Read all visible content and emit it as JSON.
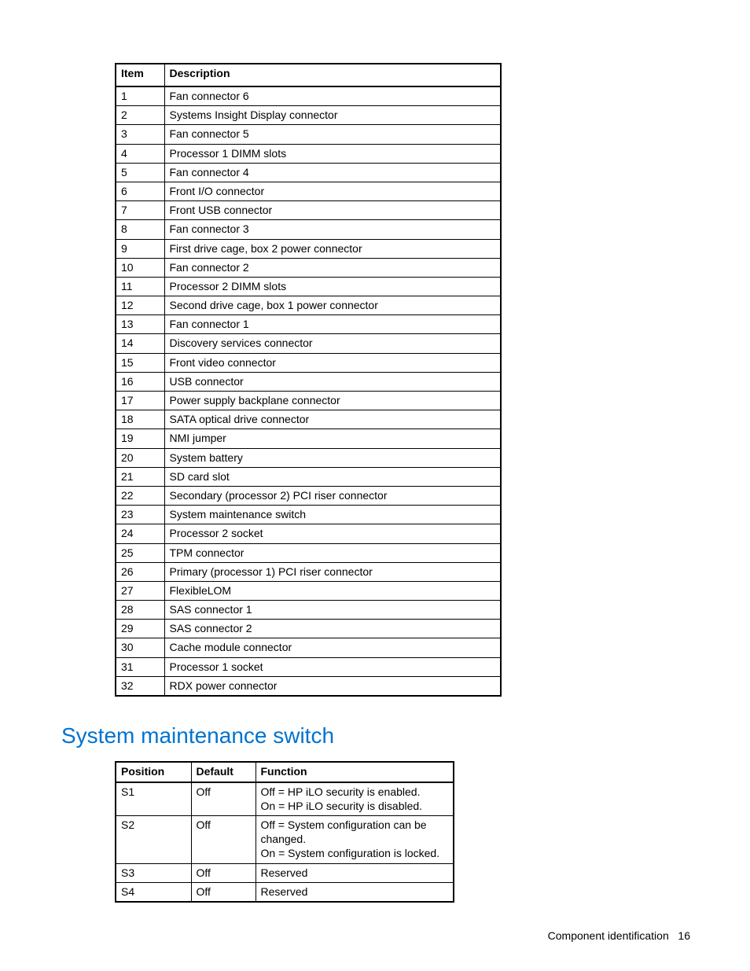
{
  "table1": {
    "headers": {
      "item": "Item",
      "desc": "Description"
    },
    "rows": [
      {
        "item": "1",
        "desc": "Fan connector 6"
      },
      {
        "item": "2",
        "desc": "Systems Insight Display connector"
      },
      {
        "item": "3",
        "desc": "Fan connector 5"
      },
      {
        "item": "4",
        "desc": "Processor 1 DIMM slots"
      },
      {
        "item": "5",
        "desc": "Fan connector 4"
      },
      {
        "item": "6",
        "desc": "Front I/O connector"
      },
      {
        "item": "7",
        "desc": "Front USB connector"
      },
      {
        "item": "8",
        "desc": "Fan connector 3"
      },
      {
        "item": "9",
        "desc": "First drive cage, box 2 power connector"
      },
      {
        "item": "10",
        "desc": "Fan connector 2"
      },
      {
        "item": "11",
        "desc": "Processor 2 DIMM slots"
      },
      {
        "item": "12",
        "desc": "Second drive cage, box 1 power connector"
      },
      {
        "item": "13",
        "desc": "Fan connector 1"
      },
      {
        "item": "14",
        "desc": "Discovery services connector"
      },
      {
        "item": "15",
        "desc": "Front video connector"
      },
      {
        "item": "16",
        "desc": "USB connector"
      },
      {
        "item": "17",
        "desc": "Power supply backplane connector"
      },
      {
        "item": "18",
        "desc": "SATA optical drive connector"
      },
      {
        "item": "19",
        "desc": "NMI jumper"
      },
      {
        "item": "20",
        "desc": "System battery"
      },
      {
        "item": "21",
        "desc": "SD card slot"
      },
      {
        "item": "22",
        "desc": "Secondary (processor 2) PCI riser connector"
      },
      {
        "item": "23",
        "desc": "System maintenance switch"
      },
      {
        "item": "24",
        "desc": "Processor 2 socket"
      },
      {
        "item": "25",
        "desc": "TPM connector"
      },
      {
        "item": "26",
        "desc": "Primary (processor 1) PCI riser connector"
      },
      {
        "item": "27",
        "desc": "FlexibleLOM"
      },
      {
        "item": "28",
        "desc": "SAS connector 1"
      },
      {
        "item": "29",
        "desc": "SAS connector 2"
      },
      {
        "item": "30",
        "desc": "Cache module connector"
      },
      {
        "item": "31",
        "desc": "Processor 1 socket"
      },
      {
        "item": "32",
        "desc": "RDX power connector"
      }
    ]
  },
  "section_heading": "System maintenance switch",
  "table2": {
    "headers": {
      "pos": "Position",
      "def": "Default",
      "func": "Function"
    },
    "rows": [
      {
        "pos": "S1",
        "def": "Off",
        "func": "Off = HP iLO security is enabled.\nOn = HP iLO security is disabled."
      },
      {
        "pos": "S2",
        "def": "Off",
        "func": "Off = System configuration can be changed.\nOn = System configuration is locked."
      },
      {
        "pos": "S3",
        "def": "Off",
        "func": "Reserved"
      },
      {
        "pos": "S4",
        "def": "Off",
        "func": "Reserved"
      }
    ]
  },
  "footer": {
    "section": "Component identification",
    "page": "16"
  }
}
